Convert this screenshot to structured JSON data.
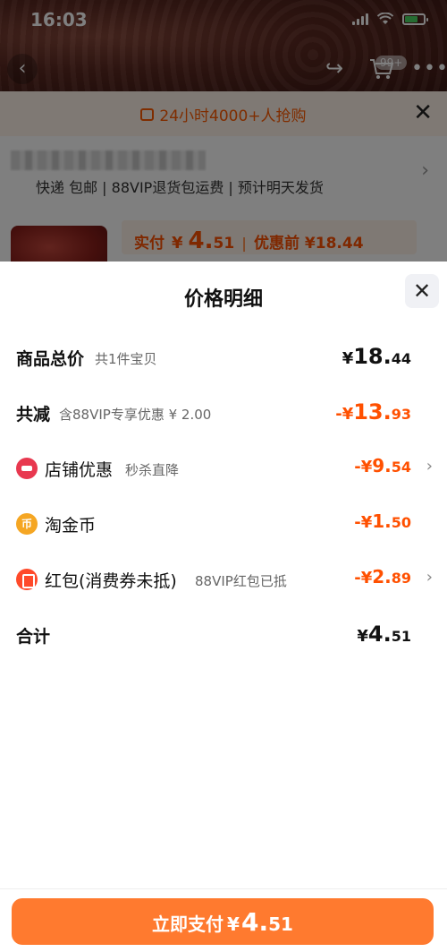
{
  "status_bar": {
    "time": "16:03"
  },
  "header": {
    "cart_badge": "99+"
  },
  "promo": {
    "text": "24小时4000+人抢购"
  },
  "address": {
    "sub": "快递 包邮 | 88VIP退货包运费 | 预计明天发货"
  },
  "price_bar": {
    "paid_label": "实付",
    "currency": "¥",
    "paid_int": "4.",
    "paid_dec": "51",
    "separator": "|",
    "before_label": "优惠前 ¥18.44"
  },
  "sheet": {
    "title": "价格明细"
  },
  "rows": {
    "total": {
      "label": "商品总价",
      "sub": "共1件宝贝",
      "currency": "¥",
      "int": "18.",
      "dec": "44"
    },
    "reduce": {
      "label": "共减",
      "sub": "含88VIP专享优惠 ¥ 2.00",
      "currency": "-¥",
      "int": "13.",
      "dec": "93"
    },
    "shop": {
      "label": "店铺优惠",
      "sub": "秒杀直降",
      "currency": "-¥",
      "int": "9.",
      "dec": "54"
    },
    "coin": {
      "label": "淘金币",
      "icon_text": "币",
      "currency": "-¥",
      "int": "1.",
      "dec": "50"
    },
    "packet": {
      "label": "红包(消费券未抵)",
      "sub": "88VIP红包已抵",
      "currency": "-¥",
      "int": "2.",
      "dec": "89"
    },
    "sum": {
      "label": "合计",
      "currency": "¥",
      "int": "4.",
      "dec": "51"
    }
  },
  "pay_button": {
    "label": "立即支付",
    "currency": "¥",
    "int": "4.",
    "dec": "51"
  },
  "colors": {
    "accent": "#ff5000",
    "button": "#ff7a2f"
  }
}
